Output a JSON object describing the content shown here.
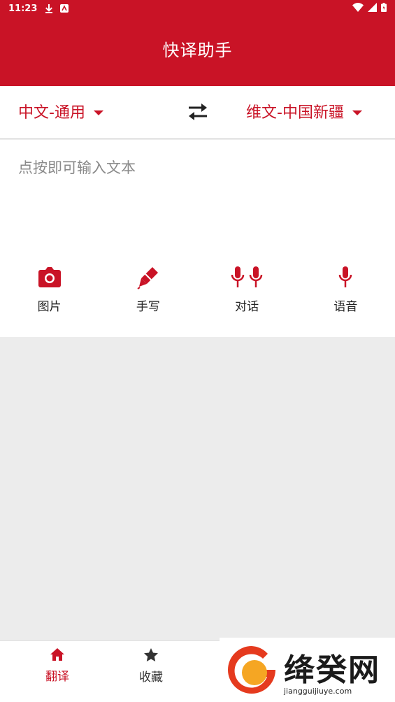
{
  "status_bar": {
    "time": "11:23"
  },
  "app": {
    "title": "快译助手"
  },
  "languages": {
    "source": "中文-通用",
    "target": "维文-中国新疆"
  },
  "input": {
    "placeholder": "点按即可输入文本"
  },
  "tools": [
    {
      "label": "图片",
      "icon": "camera-icon"
    },
    {
      "label": "手写",
      "icon": "pen-icon"
    },
    {
      "label": "对话",
      "icon": "dual-mic-icon"
    },
    {
      "label": "语音",
      "icon": "mic-icon"
    }
  ],
  "bottom_nav": [
    {
      "label": "翻译",
      "icon": "home-icon",
      "active": true
    },
    {
      "label": "收藏",
      "icon": "star-icon",
      "active": false
    }
  ],
  "watermark": {
    "logo_text": "绛癸网",
    "url": "jiangguijiuye.com"
  },
  "colors": {
    "brand": "#c91326",
    "background": "#ececec"
  }
}
